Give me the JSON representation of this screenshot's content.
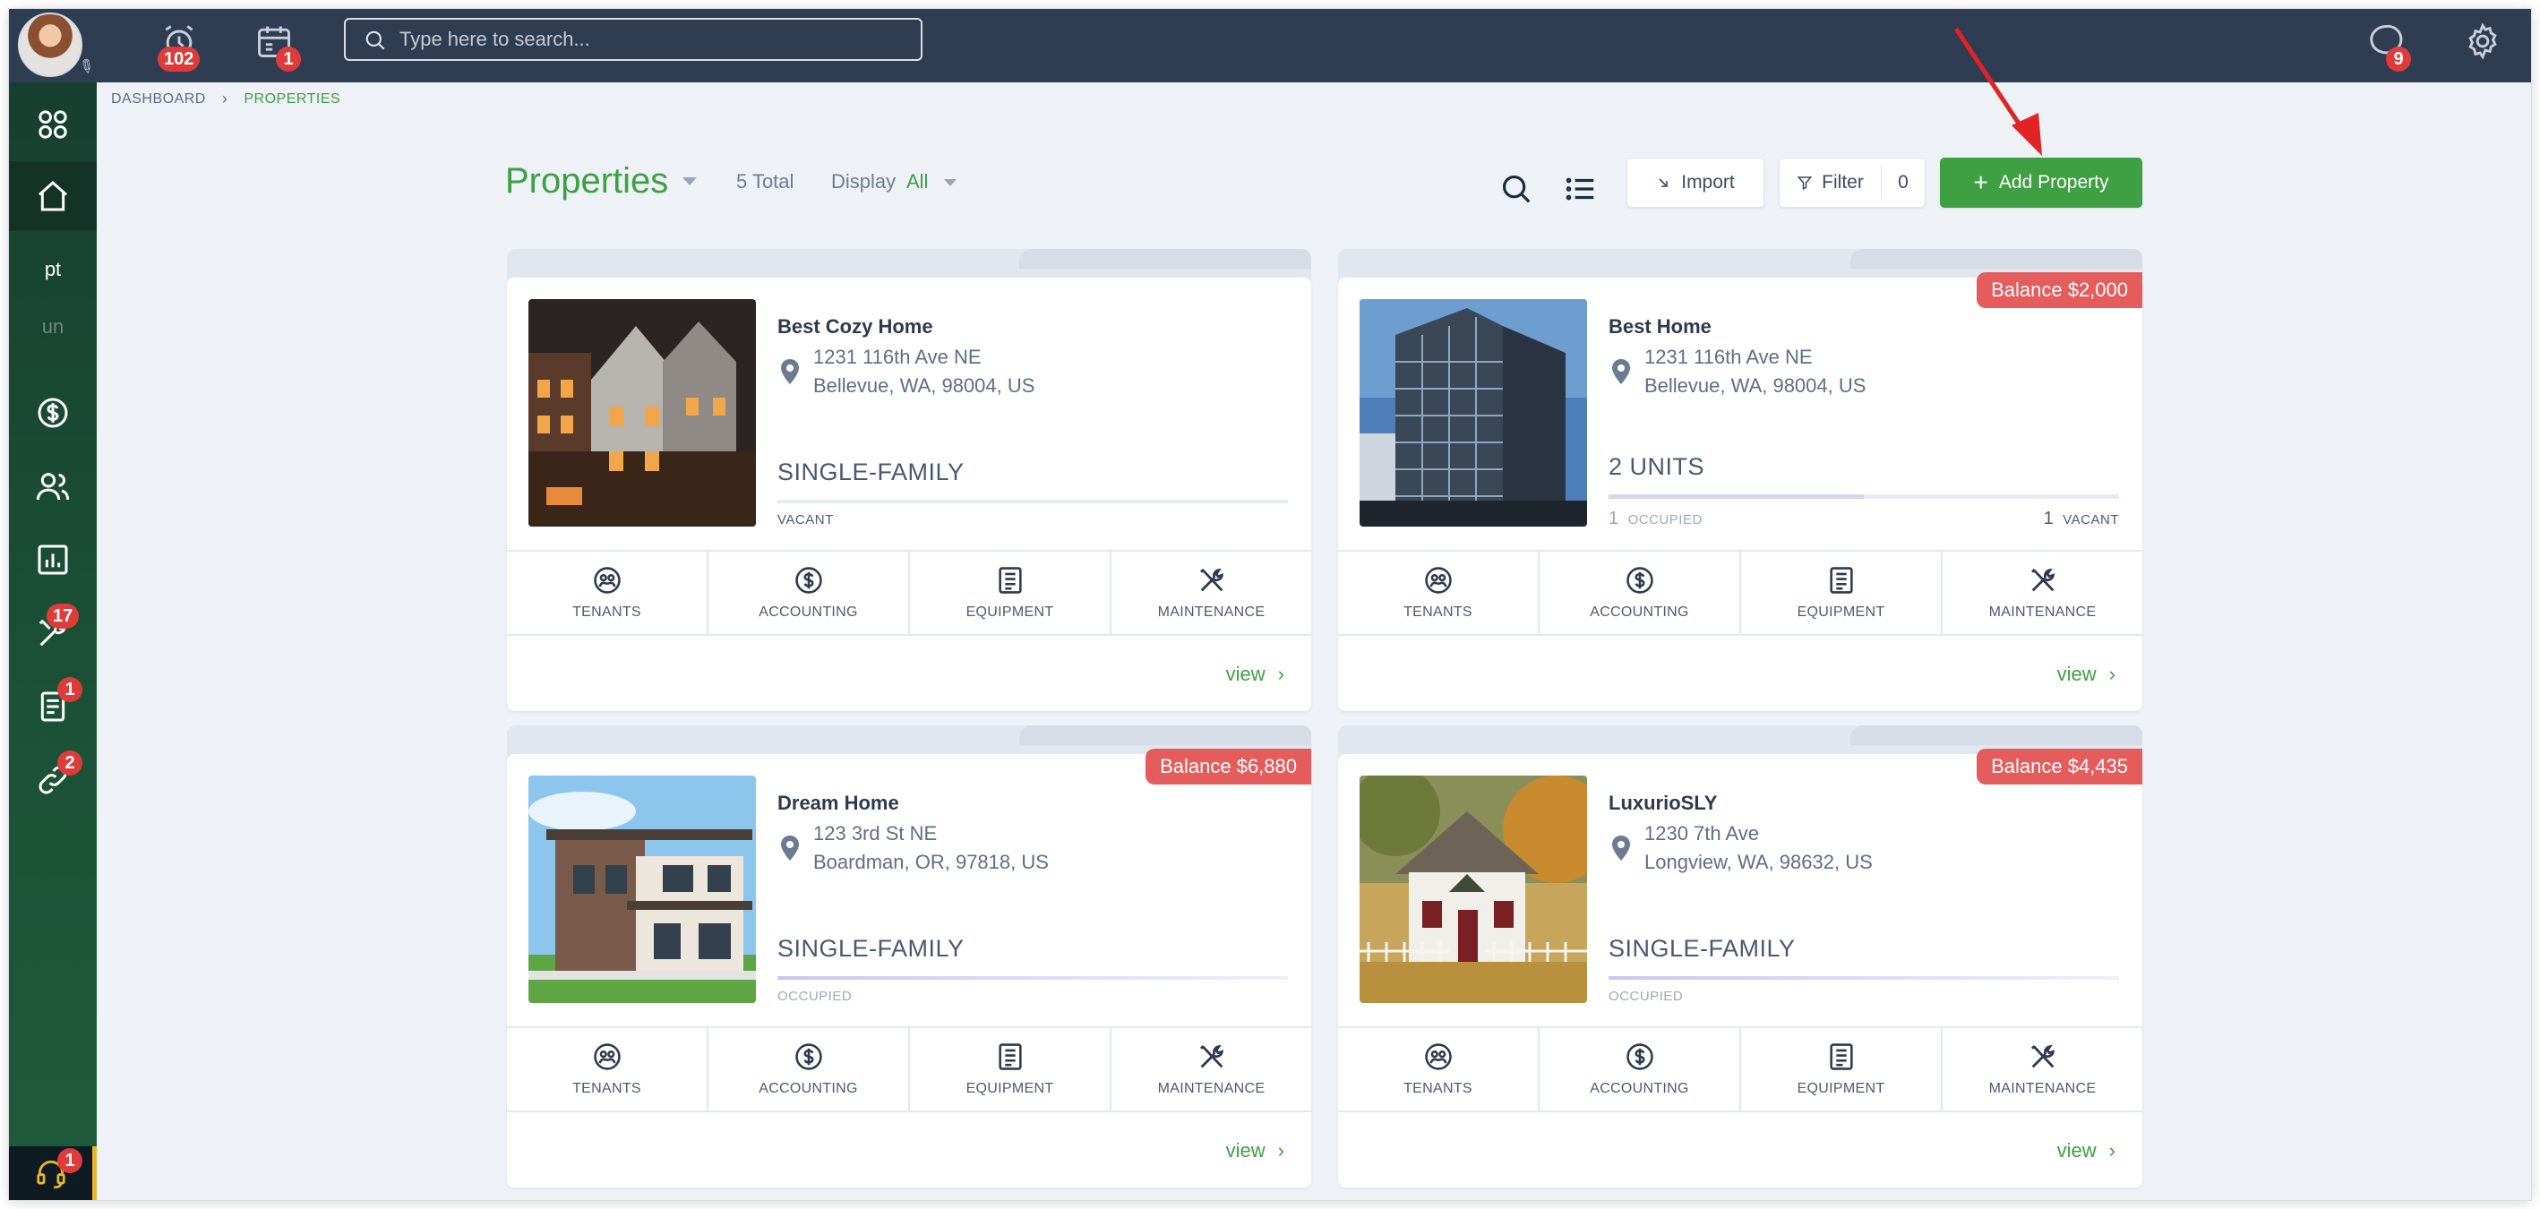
{
  "topbar": {
    "alarm_badge": "102",
    "calendar_badge": "1",
    "search_placeholder": "Type here to search...",
    "chat_badge": "9"
  },
  "sidebar": {
    "abbr_1": "pt",
    "abbr_2": "un",
    "maintenance_badge": "17",
    "documents_badge": "1",
    "links_badge": "2",
    "support_badge": "1"
  },
  "breadcrumb": [
    "DASHBOARD",
    "PROPERTIES"
  ],
  "header": {
    "title": "Properties",
    "total": "5 Total",
    "display_label": "Display",
    "display_value": "All",
    "import_label": "Import",
    "filter_label": "Filter",
    "filter_count": "0",
    "add_label": "Add Property"
  },
  "action_labels": [
    "TENANTS",
    "ACCOUNTING",
    "EQUIPMENT",
    "MAINTENANCE"
  ],
  "view_label": "view",
  "properties": [
    {
      "name": "Best Cozy Home",
      "address1": "1231 116th Ave NE",
      "address2": "Bellevue, WA, 98004, US",
      "type": "SINGLE-FAMILY",
      "status": "VACANT",
      "balance": ""
    },
    {
      "name": "Best Home",
      "address1": "1231 116th Ave NE",
      "address2": "Bellevue, WA, 98004, US",
      "type": "2 UNITS",
      "occupied_count": "1",
      "occupied_label": "OCCUPIED",
      "vacant_count": "1",
      "vacant_label": "VACANT",
      "balance": "Balance $2,000"
    },
    {
      "name": "Dream Home",
      "address1": "123 3rd St NE",
      "address2": "Boardman, OR, 97818, US",
      "type": "SINGLE-FAMILY",
      "status": "OCCUPIED",
      "balance": "Balance $6,880"
    },
    {
      "name": "LuxurioSLY",
      "address1": "1230 7th Ave",
      "address2": "Longview, WA, 98632, US",
      "type": "SINGLE-FAMILY",
      "status": "OCCUPIED",
      "balance": "Balance $4,435"
    }
  ],
  "colors": {
    "accent_green": "#3ea043",
    "topbar": "#2f3d53",
    "balance_red": "#e45c5c",
    "badge_red": "#e03b3b"
  }
}
